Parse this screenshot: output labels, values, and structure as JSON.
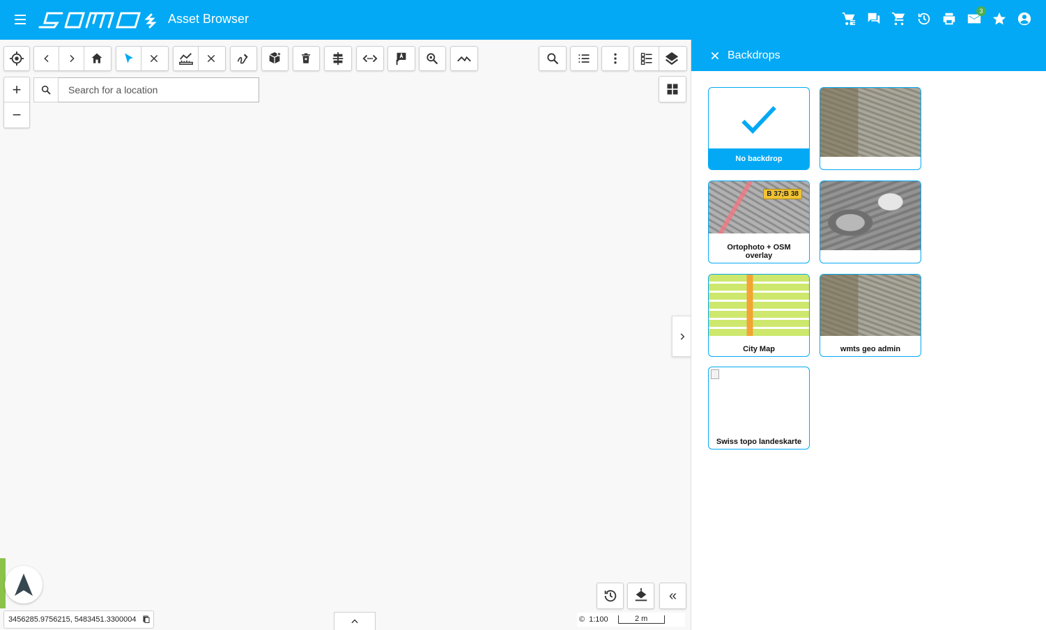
{
  "header": {
    "app_title": "Asset Browser",
    "logo_text": "samo",
    "icons": [
      "cart-list-icon",
      "chat-icon",
      "cart-icon",
      "history-icon",
      "print-icon",
      "mail-icon",
      "star-icon",
      "account-icon"
    ],
    "mail_badge": "3",
    "color": "#03a9f4"
  },
  "map": {
    "search_placeholder": "Search for a location",
    "coordinates": "3456285.9756215, 5483451.3300004",
    "scale_ratio": "1:100",
    "scale_bar_label": "2 m",
    "copyright_symbol": "©",
    "zoom_in": "+",
    "zoom_out": "−",
    "collapse_label": "«"
  },
  "panel": {
    "title": "Backdrops",
    "tiles": [
      {
        "label": "No backdrop",
        "selected": true
      },
      {
        "label": ""
      },
      {
        "label": "Ortophoto + OSM overlay",
        "road_label": "B 37;B 38"
      },
      {
        "label": ""
      },
      {
        "label": "City Map"
      },
      {
        "label": "wmts geo admin"
      },
      {
        "label": "Swiss topo landeskarte"
      }
    ]
  }
}
